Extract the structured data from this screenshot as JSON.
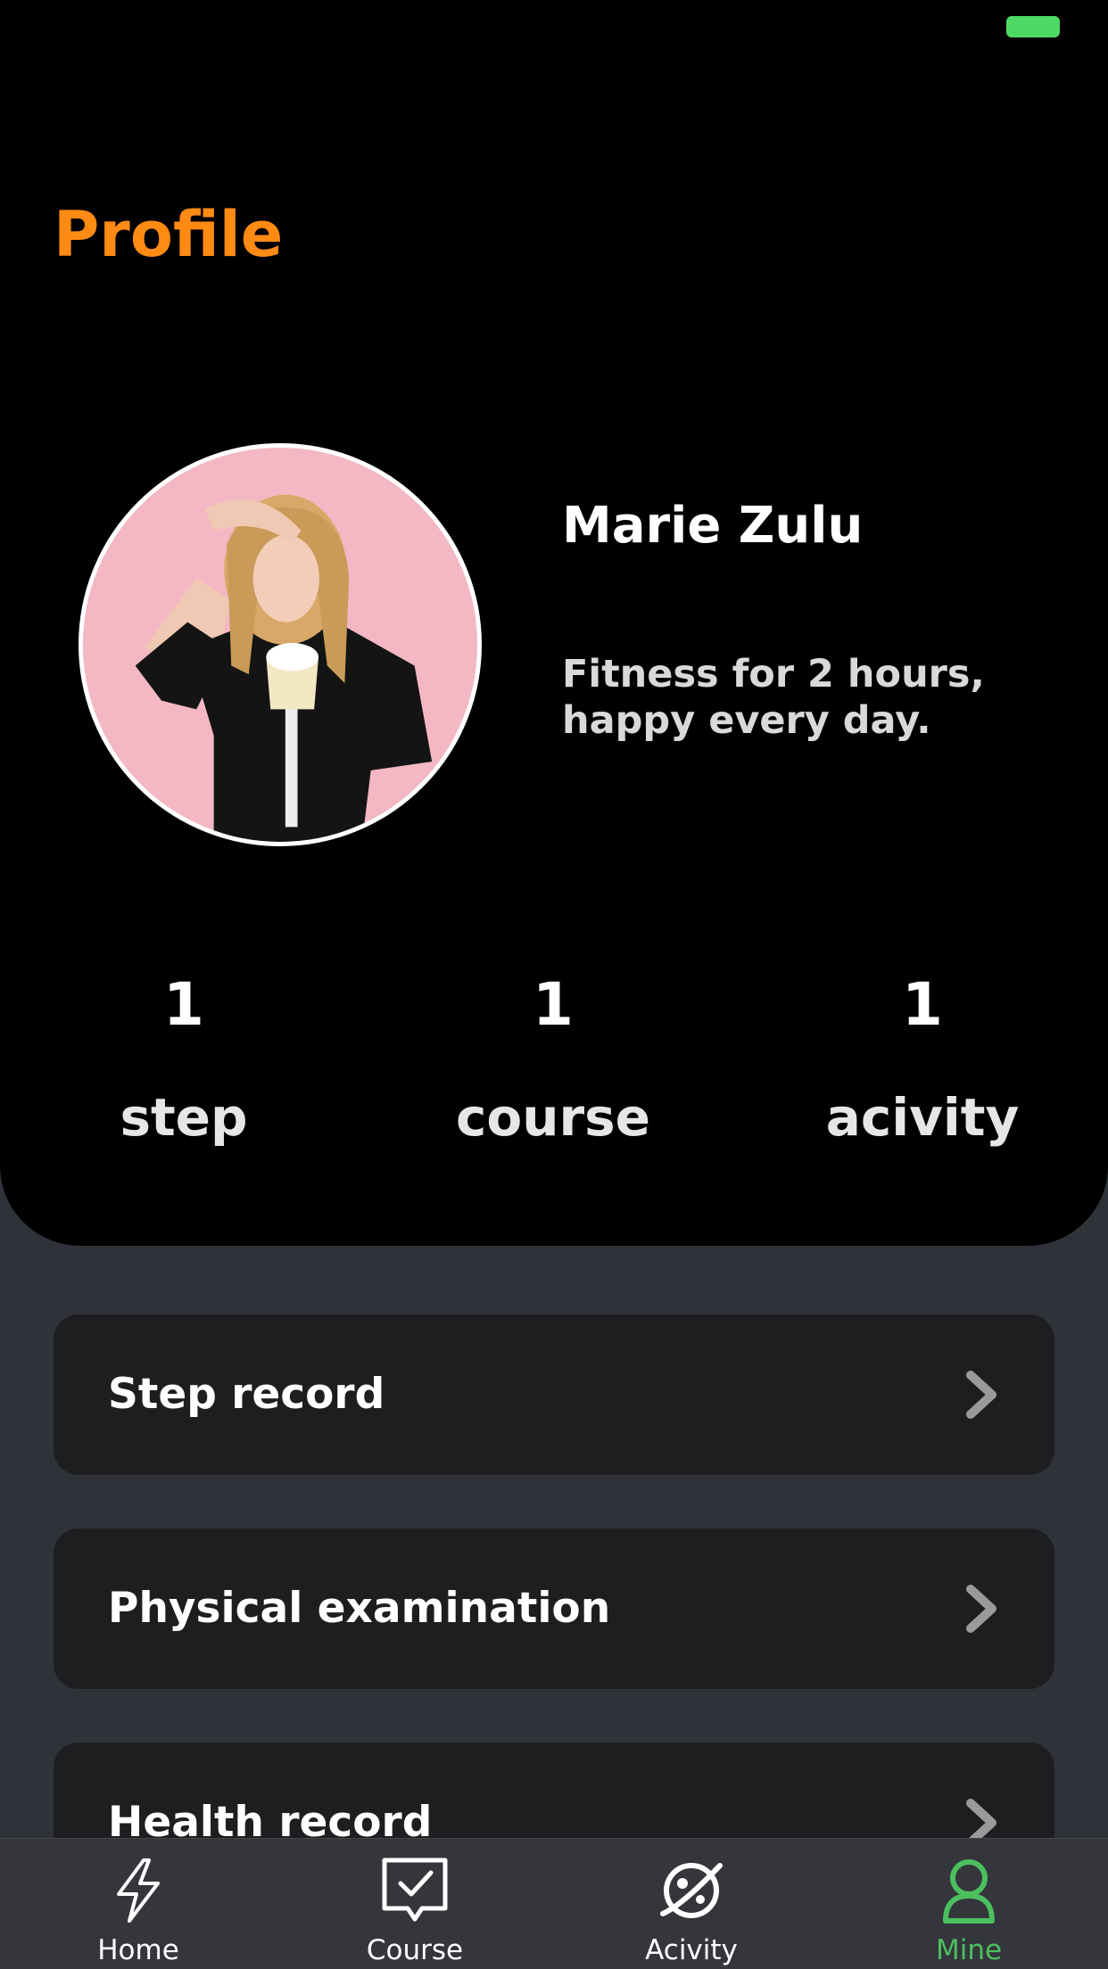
{
  "theme": {
    "accent": "#ff8a14",
    "active_tab": "#4cbf5e",
    "battery": "#4cd964",
    "background": "#2f3239",
    "card": "#1e1e20"
  },
  "header": {
    "title": "Profile"
  },
  "profile": {
    "name": "Marie Zulu",
    "bio": "Fitness for 2 hours, happy every day."
  },
  "stats": [
    {
      "value": "1",
      "label": "step"
    },
    {
      "value": "1",
      "label": "course"
    },
    {
      "value": "1",
      "label": "acivity"
    }
  ],
  "menu": [
    {
      "label": "Step record",
      "icon": "chevron-right-icon"
    },
    {
      "label": "Physical examination",
      "icon": "chevron-right-icon"
    },
    {
      "label": "Health record",
      "icon": "chevron-right-icon"
    }
  ],
  "tabbar": {
    "items": [
      {
        "label": "Home",
        "icon": "lightning-icon"
      },
      {
        "label": "Course",
        "icon": "checklist-chat-icon"
      },
      {
        "label": "Acivity",
        "icon": "planet-icon"
      },
      {
        "label": "Mine",
        "icon": "person-icon",
        "active": true
      }
    ]
  }
}
